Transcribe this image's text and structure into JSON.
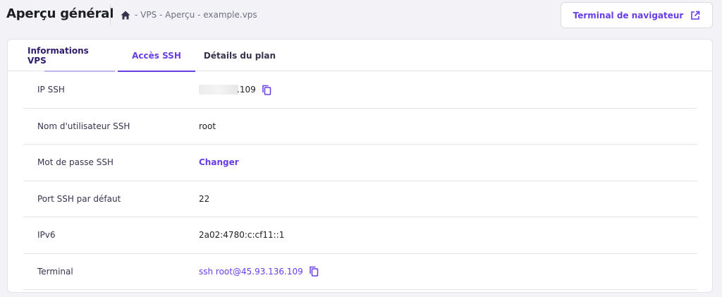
{
  "header": {
    "title": "Aperçu général",
    "breadcrumb": [
      "- VPS",
      " - Aperçu",
      " - example.vps"
    ],
    "terminal_button_label": "Terminal de navigateur"
  },
  "tabs": [
    {
      "label": "Informations VPS",
      "active": false
    },
    {
      "label": "Accès SSH",
      "active": true
    },
    {
      "label": "Détails du plan",
      "active": false
    }
  ],
  "ssh_rows": [
    {
      "label": "IP SSH",
      "value": ".109"
    },
    {
      "label": "Nom d'utilisateur SSH",
      "value": "root"
    },
    {
      "label": "Mot de passe SSH",
      "value": "Changer"
    },
    {
      "label": "Port SSH par défaut",
      "value": "22"
    },
    {
      "label": "IPv6",
      "value": "2a02:4780:c:cf11::1"
    },
    {
      "label": "Terminal",
      "value": "ssh root@45.93.136.109"
    }
  ],
  "colors": {
    "accent": "#673de6",
    "title": "#1d1e20",
    "muted": "#6d7081",
    "background": "#f3f3f7"
  },
  "icons": {
    "home": "home-icon",
    "external": "external-link-icon",
    "copy": "copy-icon"
  }
}
